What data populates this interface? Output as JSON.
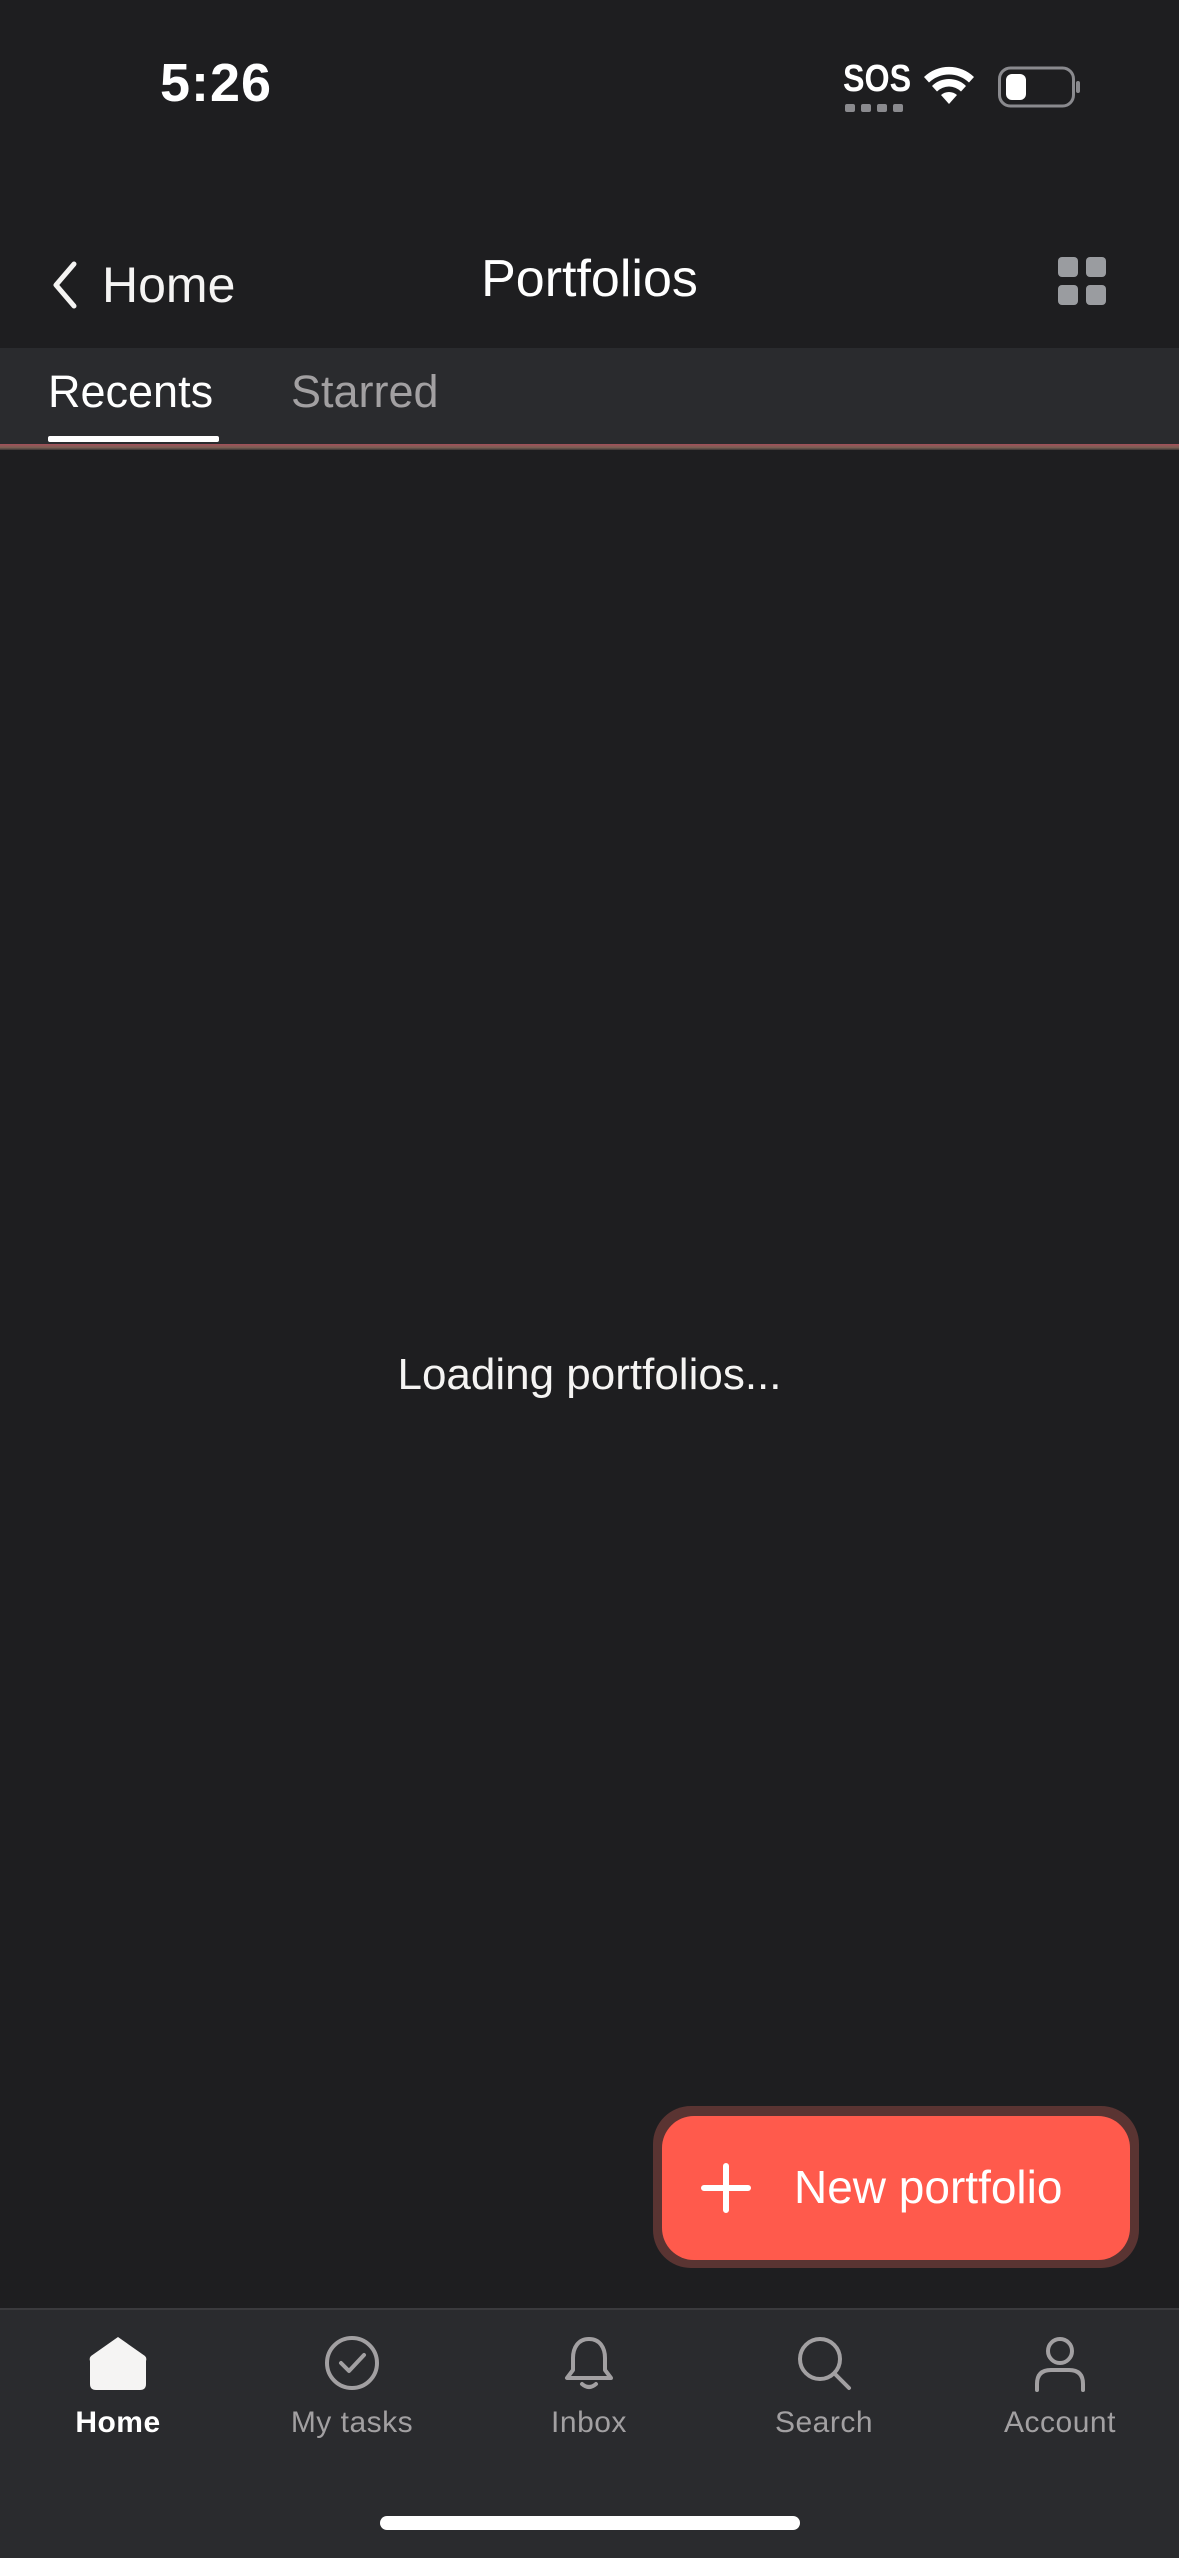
{
  "status_bar": {
    "time": "5:26",
    "sos_label": "SOS",
    "icons": [
      "wifi-icon",
      "battery-icon"
    ]
  },
  "header": {
    "back_label": "Home",
    "title": "Portfolios",
    "back_icon": "chevron-left-icon",
    "view_toggle_icon": "grid-icon"
  },
  "tabs": [
    {
      "label": "Recents",
      "active": true
    },
    {
      "label": "Starred",
      "active": false
    }
  ],
  "main": {
    "loading_text": "Loading portfolios..."
  },
  "fab": {
    "label": "New portfolio",
    "icon": "plus-icon",
    "color": "#ff5a4c"
  },
  "bottom_nav": {
    "items": [
      {
        "label": "Home",
        "icon": "home-icon",
        "active": true
      },
      {
        "label": "My tasks",
        "icon": "check-circle-icon",
        "active": false
      },
      {
        "label": "Inbox",
        "icon": "bell-icon",
        "active": false
      },
      {
        "label": "Search",
        "icon": "search-icon",
        "active": false
      },
      {
        "label": "Account",
        "icon": "person-icon",
        "active": false
      }
    ]
  },
  "colors": {
    "background": "#1e1e20",
    "surface": "#2a2b2e",
    "accent": "#ff5a4c",
    "text_primary": "#f5f4f3",
    "text_secondary": "#a2a0a2"
  }
}
